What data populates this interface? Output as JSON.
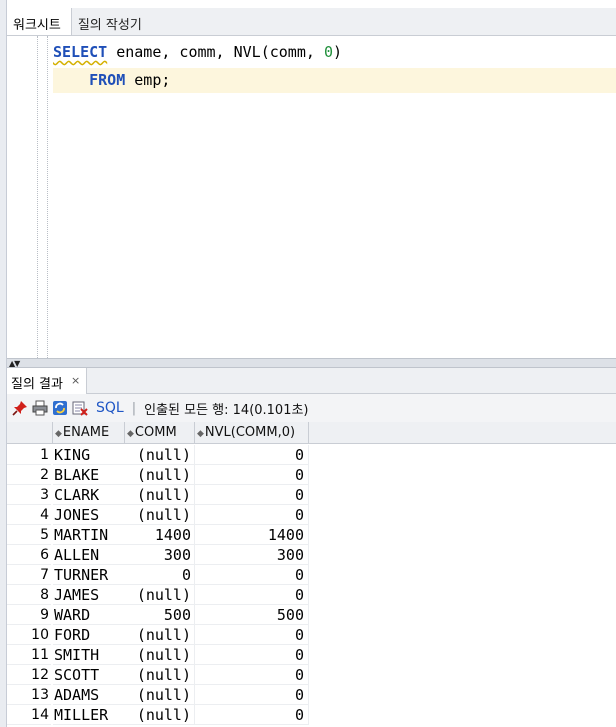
{
  "editor": {
    "tabs": [
      {
        "label": "워크시트",
        "active": true
      },
      {
        "label": "질의 작성기",
        "active": false
      }
    ],
    "code": {
      "line1": {
        "kw": "SELECT",
        "rest_a": " ename, comm, NVL(comm, ",
        "num": "0",
        "rest_b": ")"
      },
      "line2": {
        "indent": "    ",
        "kw": "FROM",
        "rest": " emp;"
      }
    }
  },
  "splitter": {
    "arrows": "▲▼"
  },
  "result_panel": {
    "tab_label": "질의 결과",
    "close_glyph": "×",
    "toolbar": {
      "icons": [
        "pin-icon",
        "print-icon",
        "refresh-icon",
        "export-icon"
      ],
      "sql_label": "SQL",
      "separator": "|",
      "status": "인출된 모든 행: 14(0.101초)"
    },
    "columns": [
      {
        "label": "ENAME"
      },
      {
        "label": "COMM"
      },
      {
        "label": "NVL(COMM,0)"
      }
    ],
    "rows": [
      {
        "n": "1",
        "ename": "KING",
        "comm": "(null)",
        "nvl": "0"
      },
      {
        "n": "2",
        "ename": "BLAKE",
        "comm": "(null)",
        "nvl": "0"
      },
      {
        "n": "3",
        "ename": "CLARK",
        "comm": "(null)",
        "nvl": "0"
      },
      {
        "n": "4",
        "ename": "JONES",
        "comm": "(null)",
        "nvl": "0"
      },
      {
        "n": "5",
        "ename": "MARTIN",
        "comm": "1400",
        "nvl": "1400"
      },
      {
        "n": "6",
        "ename": "ALLEN",
        "comm": "300",
        "nvl": "300"
      },
      {
        "n": "7",
        "ename": "TURNER",
        "comm": "0",
        "nvl": "0"
      },
      {
        "n": "8",
        "ename": "JAMES",
        "comm": "(null)",
        "nvl": "0"
      },
      {
        "n": "9",
        "ename": "WARD",
        "comm": "500",
        "nvl": "500"
      },
      {
        "n": "10",
        "ename": "FORD",
        "comm": "(null)",
        "nvl": "0"
      },
      {
        "n": "11",
        "ename": "SMITH",
        "comm": "(null)",
        "nvl": "0"
      },
      {
        "n": "12",
        "ename": "SCOTT",
        "comm": "(null)",
        "nvl": "0"
      },
      {
        "n": "13",
        "ename": "ADAMS",
        "comm": "(null)",
        "nvl": "0"
      },
      {
        "n": "14",
        "ename": "MILLER",
        "comm": "(null)",
        "nvl": "0"
      }
    ]
  }
}
